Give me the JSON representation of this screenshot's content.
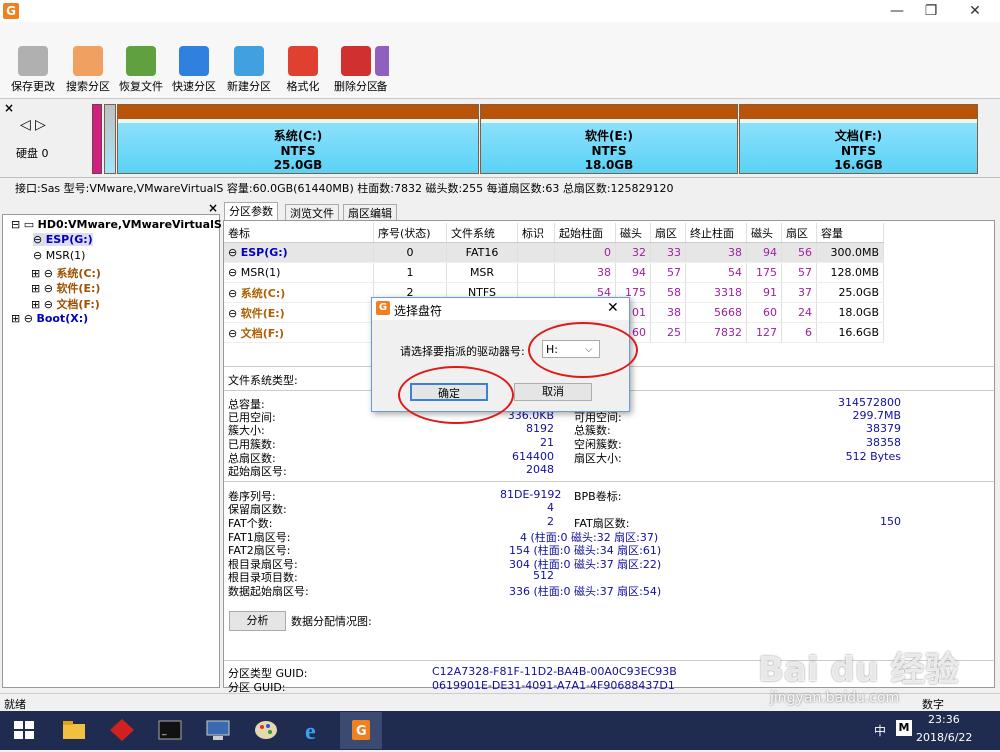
{
  "window": {
    "minimize_label": "—",
    "restore_label": "❐",
    "close_label": "✕"
  },
  "toolbar": [
    {
      "label": "保存更改",
      "color": "#b0b0b0"
    },
    {
      "label": "搜索分区",
      "color": "#f0a060"
    },
    {
      "label": "恢复文件",
      "color": "#60a040"
    },
    {
      "label": "快速分区",
      "color": "#3080e0"
    },
    {
      "label": "新建分区",
      "color": "#40a0e0"
    },
    {
      "label": "格式化",
      "color": "#e04030"
    },
    {
      "label": "删除分区",
      "color": "#d03030"
    },
    {
      "label": "备",
      "color": "#9060c0"
    }
  ],
  "disk": {
    "label": "硬盘 0",
    "partitions": [
      {
        "name": "系统(C:)",
        "fs": "NTFS",
        "size": "25.0GB"
      },
      {
        "name": "软件(E:)",
        "fs": "NTFS",
        "size": "18.0GB"
      },
      {
        "name": "文档(F:)",
        "fs": "NTFS",
        "size": "16.6GB"
      }
    ],
    "info": "接口:Sas  型号:VMware,VMwareVirtualS  容量:60.0GB(61440MB)  柱面数:7832  磁头数:255  每道扇区数:63  总扇区数:125829120"
  },
  "tree": {
    "root": "HD0:VMware,VMwareVirtualS",
    "items": [
      {
        "label": "ESP(G:)",
        "selected": true
      },
      {
        "label": "MSR(1)"
      },
      {
        "label": "系统(C:)"
      },
      {
        "label": "软件(E:)"
      },
      {
        "label": "文档(F:)"
      }
    ],
    "boot": "Boot(X:)"
  },
  "tabs": [
    "分区参数",
    "浏览文件",
    "扇区编辑"
  ],
  "table": {
    "headers": [
      "卷标",
      "序号(状态)",
      "文件系统",
      "标识",
      "起始柱面",
      "磁头",
      "扇区",
      "终止柱面",
      "磁头",
      "扇区",
      "容量"
    ],
    "rows": [
      [
        "ESP(G:)",
        "0",
        "FAT16",
        "",
        "0",
        "32",
        "33",
        "38",
        "94",
        "56",
        "300.0MB"
      ],
      [
        "MSR(1)",
        "1",
        "MSR",
        "",
        "38",
        "94",
        "57",
        "54",
        "175",
        "57",
        "128.0MB"
      ],
      [
        "系统(C:)",
        "2",
        "NTFS",
        "",
        "54",
        "175",
        "58",
        "3318",
        "91",
        "37",
        "25.0GB"
      ],
      [
        "软件(E:)",
        "",
        "",
        "",
        "",
        "01",
        "38",
        "5668",
        "60",
        "24",
        "18.0GB"
      ],
      [
        "文档(F:)",
        "",
        "",
        "",
        "",
        "60",
        "25",
        "7832",
        "127",
        "6",
        "16.6GB"
      ]
    ]
  },
  "fs_info": {
    "title": "文件系统类型:",
    "left": [
      {
        "k": "总容量:",
        "v": ""
      },
      {
        "k": "已用空间:",
        "v": "336.0KB"
      },
      {
        "k": "簇大小:",
        "v": "8192"
      },
      {
        "k": "已用簇数:",
        "v": "21"
      },
      {
        "k": "总扇区数:",
        "v": "614400"
      },
      {
        "k": "起始扇区号:",
        "v": "2048"
      }
    ],
    "right": [
      {
        "k": "",
        "v": "314572800"
      },
      {
        "k": "可用空间:",
        "v": "299.7MB"
      },
      {
        "k": "总簇数:",
        "v": "38379"
      },
      {
        "k": "空闲簇数:",
        "v": "38358"
      },
      {
        "k": "扇区大小:",
        "v": "512 Bytes"
      }
    ],
    "lower": [
      {
        "k": "卷序列号:",
        "v": "81DE-9192"
      },
      {
        "k": "保留扇区数:",
        "v": "4"
      },
      {
        "k": "FAT个数:",
        "v": "2"
      },
      {
        "k": "FAT1扇区号:",
        "v": "4 (柱面:0 磁头:32 扇区:37)"
      },
      {
        "k": "FAT2扇区号:",
        "v": "154 (柱面:0 磁头:34 扇区:61)"
      },
      {
        "k": "根目录扇区号:",
        "v": "304 (柱面:0 磁头:37 扇区:22)"
      },
      {
        "k": "根目录项目数:",
        "v": "512"
      },
      {
        "k": "数据起始扇区号:",
        "v": "336 (柱面:0 磁头:37 扇区:54)"
      }
    ],
    "bpb_label": "BPB卷标:",
    "fat_sectors_label": "FAT扇区数:",
    "fat_sectors_value": "150",
    "analyze_button": "分析",
    "distribution_label": "数据分配情况图:",
    "guid_type_label": "分区类型 GUID:",
    "guid_type": "C12A7328-F81F-11D2-BA4B-00A0C93EC93B",
    "guid_label": "分区 GUID:",
    "guid": "0619901E-DE31-4091-A7A1-4F90688437D1"
  },
  "dialog": {
    "title": "选择盘符",
    "prompt": "请选择要指派的驱动器号:",
    "selected_drive": "H:",
    "ok": "确定",
    "cancel": "取消"
  },
  "status": {
    "left": "就绪",
    "right": "数字"
  },
  "taskbar": {
    "time": "23:36",
    "date": "2018/6/22",
    "ime": "中",
    "ime2": "M"
  },
  "watermark": {
    "brand": "Bai du 经验",
    "site": "jingyan.baidu.com"
  }
}
